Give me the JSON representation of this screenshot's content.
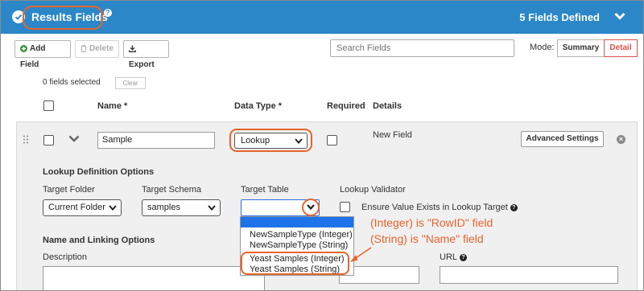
{
  "header": {
    "title": "Results Fields",
    "help": "?",
    "fields_defined": "5 Fields Defined"
  },
  "toolbar": {
    "add_field": "Add Field",
    "delete": "Delete",
    "export": "Export",
    "search_placeholder": "Search Fields",
    "mode_label": "Mode:",
    "mode_summary": "Summary",
    "mode_detail": "Detail",
    "selected_mode": "Detail"
  },
  "selection": {
    "count_text": "0 fields selected",
    "clear": "Clear"
  },
  "columns": {
    "name": "Name *",
    "data_type": "Data Type *",
    "required": "Required",
    "details": "Details"
  },
  "field_row": {
    "name_value": "Sample",
    "data_type_value": "Lookup",
    "details": "New Field",
    "advanced_settings": "Advanced Settings",
    "remove": "×"
  },
  "lookup": {
    "section_title": "Lookup Definition Options",
    "target_folder_label": "Target Folder",
    "target_folder_value": "Current Folder",
    "target_schema_label": "Target Schema",
    "target_schema_value": "samples",
    "target_table_label": "Target Table",
    "target_table_value": "",
    "validator_label": "Lookup Validator",
    "validator_option": "Ensure Value Exists in Lookup Target",
    "table_options": [
      "",
      "NewSampleType (Integer)",
      "NewSampleType (String)",
      "Yeast Samples (Integer)",
      "Yeast Samples (String)"
    ]
  },
  "annotations": {
    "integer_note": "(Integer) is \"RowID\" field",
    "string_note": "(String) is \"Name\" field"
  },
  "naming": {
    "section_title": "Name and Linking Options",
    "description_label": "Description",
    "url_label": "URL"
  },
  "colors": {
    "header_blue": "#2b87c8",
    "highlight_orange": "#e8642c",
    "detail_red": "#d9534f",
    "selection_blue": "#1e73e8",
    "row_bg": "#f0f0f0"
  }
}
